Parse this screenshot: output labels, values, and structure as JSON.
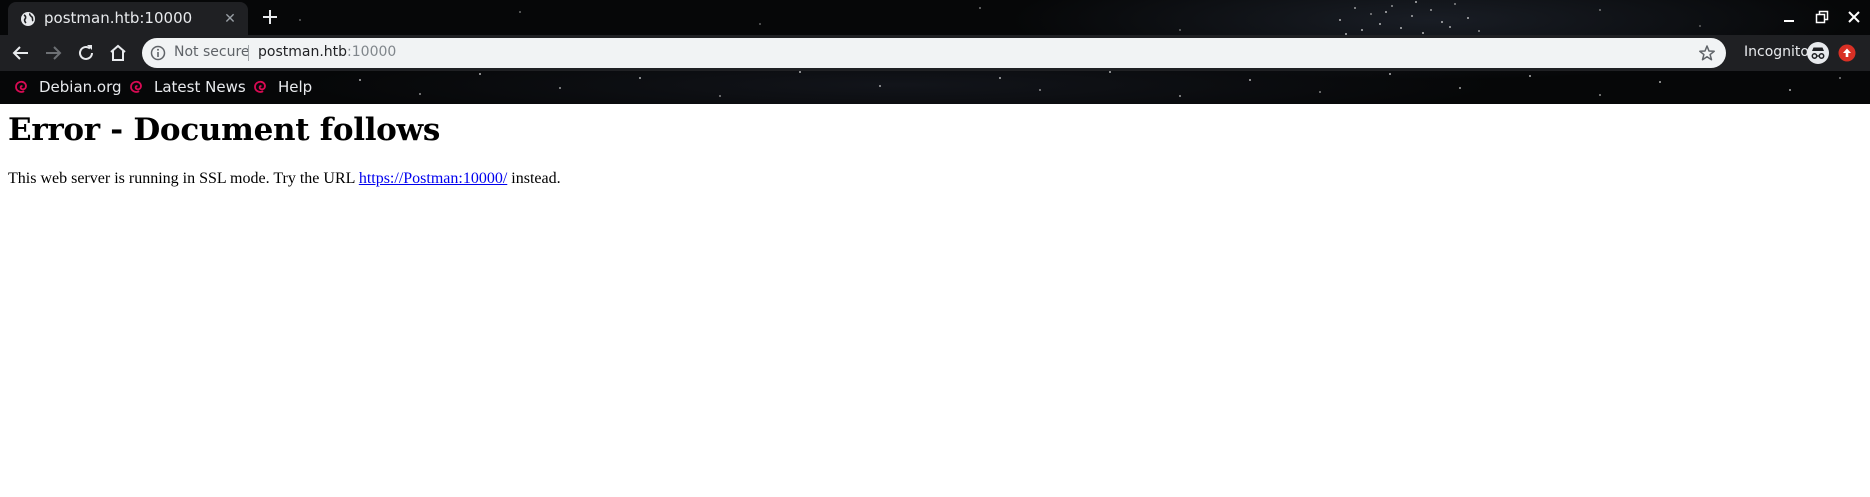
{
  "tab": {
    "title": "postman.htb:10000",
    "favicon": "globe-icon",
    "close_icon": "close-icon",
    "new_tab_icon": "plus-icon"
  },
  "window_controls": [
    "minimize-icon",
    "restore-icon",
    "close-icon"
  ],
  "toolbar": {
    "back_icon": "arrow-left-icon",
    "forward_icon": "arrow-right-icon",
    "reload_icon": "reload-icon",
    "home_icon": "home-icon"
  },
  "omnibox": {
    "security_label": "Not secure",
    "url_host": "postman.htb",
    "url_port": ":10000",
    "bookmark_star_icon": "star-icon"
  },
  "profile": {
    "label": "Incognito",
    "icon": "incognito-icon",
    "update_icon": "update-icon"
  },
  "bookmarks": [
    {
      "label": "Debian.org",
      "icon": "debian-swirl-icon"
    },
    {
      "label": "Latest News",
      "icon": "debian-swirl-icon"
    },
    {
      "label": "Help",
      "icon": "debian-swirl-icon"
    }
  ],
  "page": {
    "heading": "Error - Document follows",
    "message_before": "This web server is running in SSL mode. Try the URL ",
    "link_text": "https://Postman:10000/",
    "message_after": " instead."
  },
  "colors": {
    "chrome_bg": "#060708",
    "toolbar_bg": "#1f2023",
    "omnibox_bg": "#f1f3f4",
    "link": "#0000ee",
    "update_badge": "#d93025",
    "debian_red": "#d70a53"
  }
}
